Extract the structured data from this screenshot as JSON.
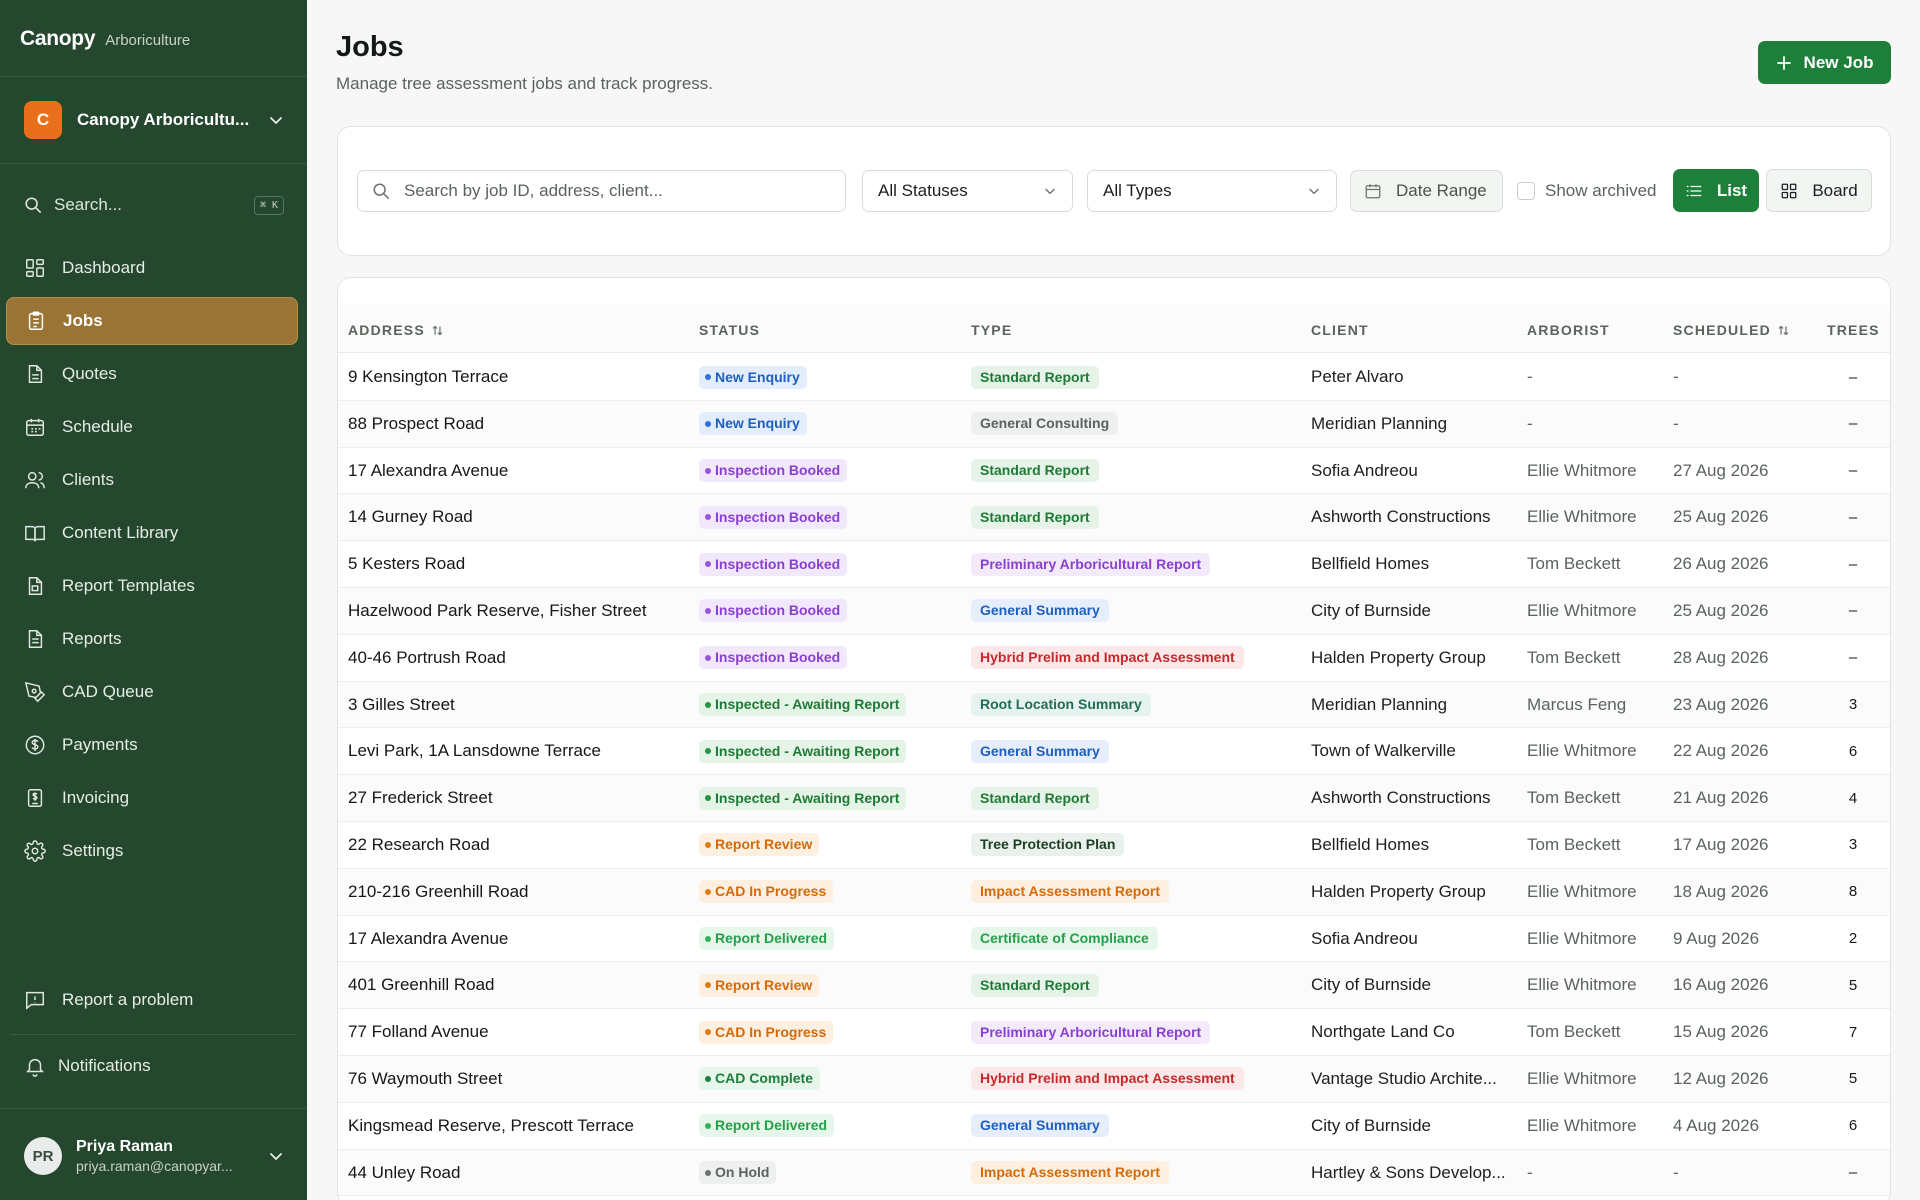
{
  "app": {
    "brand": "Canopy",
    "brand_sub": "Arboriculture"
  },
  "org": {
    "initial": "C",
    "name": "Canopy Arboricultu..."
  },
  "sidebar": {
    "search_label": "Search...",
    "search_shortcut": "⌘ K",
    "items": [
      {
        "label": "Dashboard",
        "icon": "dashboard-icon",
        "active": false
      },
      {
        "label": "Jobs",
        "icon": "clipboard-icon",
        "active": true
      },
      {
        "label": "Quotes",
        "icon": "document-icon",
        "active": false
      },
      {
        "label": "Schedule",
        "icon": "calendar-icon",
        "active": false
      },
      {
        "label": "Clients",
        "icon": "users-icon",
        "active": false
      },
      {
        "label": "Content Library",
        "icon": "book-icon",
        "active": false
      },
      {
        "label": "Report Templates",
        "icon": "template-icon",
        "active": false
      },
      {
        "label": "Reports",
        "icon": "report-icon",
        "active": false
      },
      {
        "label": "CAD Queue",
        "icon": "pen-tool-icon",
        "active": false
      },
      {
        "label": "Payments",
        "icon": "dollar-icon",
        "active": false
      },
      {
        "label": "Invoicing",
        "icon": "invoice-icon",
        "active": false
      },
      {
        "label": "Settings",
        "icon": "gear-icon",
        "active": false
      }
    ],
    "report_problem": "Report a problem",
    "notifications": "Notifications",
    "user": {
      "initials": "PR",
      "name": "Priya Raman",
      "email": "priya.raman@canopyar..."
    }
  },
  "header": {
    "title": "Jobs",
    "subtitle": "Manage tree assessment jobs and track progress.",
    "new_job_label": "New Job"
  },
  "filters": {
    "search_placeholder": "Search by job ID, address, client...",
    "status_select": "All Statuses",
    "type_select": "All Types",
    "date_range": "Date Range",
    "show_archived": "Show archived",
    "list_label": "List",
    "board_label": "Board"
  },
  "table": {
    "columns": [
      "ADDRESS",
      "STATUS",
      "TYPE",
      "CLIENT",
      "ARBORIST",
      "SCHEDULED",
      "TREES"
    ],
    "rows": [
      {
        "address": "9 Kensington Terrace",
        "status": "New Enquiry",
        "type": "Standard Report",
        "client": "Peter Alvaro",
        "arborist": "-",
        "scheduled": "-",
        "trees": "–"
      },
      {
        "address": "88 Prospect Road",
        "status": "New Enquiry",
        "type": "General Consulting",
        "client": "Meridian Planning",
        "arborist": "-",
        "scheduled": "-",
        "trees": "–"
      },
      {
        "address": "17 Alexandra Avenue",
        "status": "Inspection Booked",
        "type": "Standard Report",
        "client": "Sofia Andreou",
        "arborist": "Ellie Whitmore",
        "scheduled": "27 Aug 2026",
        "trees": "–"
      },
      {
        "address": "14 Gurney Road",
        "status": "Inspection Booked",
        "type": "Standard Report",
        "client": "Ashworth Constructions",
        "arborist": "Ellie Whitmore",
        "scheduled": "25 Aug 2026",
        "trees": "–"
      },
      {
        "address": "5 Kesters Road",
        "status": "Inspection Booked",
        "type": "Preliminary Arboricultural Report",
        "client": "Bellfield Homes",
        "arborist": "Tom Beckett",
        "scheduled": "26 Aug 2026",
        "trees": "–"
      },
      {
        "address": "Hazelwood Park Reserve, Fisher Street",
        "status": "Inspection Booked",
        "type": "General Summary",
        "client": "City of Burnside",
        "arborist": "Ellie Whitmore",
        "scheduled": "25 Aug 2026",
        "trees": "–"
      },
      {
        "address": "40-46 Portrush Road",
        "status": "Inspection Booked",
        "type": "Hybrid Prelim and Impact Assessment",
        "client": "Halden Property Group",
        "arborist": "Tom Beckett",
        "scheduled": "28 Aug 2026",
        "trees": "–"
      },
      {
        "address": "3 Gilles Street",
        "status": "Inspected - Awaiting Report",
        "type": "Root Location Summary",
        "client": "Meridian Planning",
        "arborist": "Marcus Feng",
        "scheduled": "23 Aug 2026",
        "trees": "3"
      },
      {
        "address": "Levi Park, 1A Lansdowne Terrace",
        "status": "Inspected - Awaiting Report",
        "type": "General Summary",
        "client": "Town of Walkerville",
        "arborist": "Ellie Whitmore",
        "scheduled": "22 Aug 2026",
        "trees": "6"
      },
      {
        "address": "27 Frederick Street",
        "status": "Inspected - Awaiting Report",
        "type": "Standard Report",
        "client": "Ashworth Constructions",
        "arborist": "Tom Beckett",
        "scheduled": "21 Aug 2026",
        "trees": "4"
      },
      {
        "address": "22 Research Road",
        "status": "Report Review",
        "type": "Tree Protection Plan",
        "client": "Bellfield Homes",
        "arborist": "Tom Beckett",
        "scheduled": "17 Aug 2026",
        "trees": "3"
      },
      {
        "address": "210-216 Greenhill Road",
        "status": "CAD In Progress",
        "type": "Impact Assessment Report",
        "client": "Halden Property Group",
        "arborist": "Ellie Whitmore",
        "scheduled": "18 Aug 2026",
        "trees": "8"
      },
      {
        "address": "17 Alexandra Avenue",
        "status": "Report Delivered",
        "type": "Certificate of Compliance",
        "client": "Sofia Andreou",
        "arborist": "Ellie Whitmore",
        "scheduled": "9 Aug 2026",
        "trees": "2"
      },
      {
        "address": "401 Greenhill Road",
        "status": "Report Review",
        "type": "Standard Report",
        "client": "City of Burnside",
        "arborist": "Ellie Whitmore",
        "scheduled": "16 Aug 2026",
        "trees": "5"
      },
      {
        "address": "77 Folland Avenue",
        "status": "CAD In Progress",
        "type": "Preliminary Arboricultural Report",
        "client": "Northgate Land Co",
        "arborist": "Tom Beckett",
        "scheduled": "15 Aug 2026",
        "trees": "7"
      },
      {
        "address": "76 Waymouth Street",
        "status": "CAD Complete",
        "type": "Hybrid Prelim and Impact Assessment",
        "client": "Vantage Studio Archite...",
        "arborist": "Ellie Whitmore",
        "scheduled": "12 Aug 2026",
        "trees": "5"
      },
      {
        "address": "Kingsmead Reserve, Prescott Terrace",
        "status": "Report Delivered",
        "type": "General Summary",
        "client": "City of Burnside",
        "arborist": "Ellie Whitmore",
        "scheduled": "4 Aug 2026",
        "trees": "6"
      },
      {
        "address": "44 Unley Road",
        "status": "On Hold",
        "type": "Impact Assessment Report",
        "client": "Hartley & Sons Develop...",
        "arborist": "-",
        "scheduled": "-",
        "trees": "–"
      }
    ]
  },
  "colors": {
    "sidebar_bg": "#25472e",
    "accent_green": "#1d7f3a",
    "active_nav": "#9a7434",
    "status": {
      "New Enquiry": {
        "bg": "#e3edfb",
        "fg": "#1f5fbf",
        "dot": "#2f6fdb"
      },
      "Inspection Booked": {
        "bg": "#f1e8fb",
        "fg": "#8a3fd1",
        "dot": "#9a55dd"
      },
      "Inspected - Awaiting Report": {
        "bg": "#e4f4e7",
        "fg": "#1f7a36",
        "dot": "#27923f"
      },
      "Report Review": {
        "bg": "#fdf0e0",
        "fg": "#d36a0b",
        "dot": "#e07b13"
      },
      "CAD In Progress": {
        "bg": "#fdf0e0",
        "fg": "#d36a0b",
        "dot": "#e07b13"
      },
      "Report Delivered": {
        "bg": "#e6f6ea",
        "fg": "#25a04a",
        "dot": "#2fb356"
      },
      "CAD Complete": {
        "bg": "#e6f6ea",
        "fg": "#1d7f3a",
        "dot": "#1d7f3a"
      },
      "On Hold": {
        "bg": "#eef0ef",
        "fg": "#5b635d",
        "dot": "#6b736d"
      }
    },
    "type": {
      "Standard Report": {
        "bg": "#e6f3e8",
        "fg": "#1f7a36"
      },
      "General Consulting": {
        "bg": "#eef0ef",
        "fg": "#5b635d"
      },
      "Preliminary Arboricultural Report": {
        "bg": "#f3ebfb",
        "fg": "#8a3fd1"
      },
      "General Summary": {
        "bg": "#e6eefb",
        "fg": "#1f5fbf"
      },
      "Hybrid Prelim and Impact Assessment": {
        "bg": "#fce8e8",
        "fg": "#c8282b"
      },
      "Root Location Summary": {
        "bg": "#e7f3f0",
        "fg": "#1f6e55"
      },
      "Tree Protection Plan": {
        "bg": "#eaf1ec",
        "fg": "#1e3f27"
      },
      "Impact Assessment Report": {
        "bg": "#fdf0e0",
        "fg": "#d36a0b"
      },
      "Certificate of Compliance": {
        "bg": "#e6f6ea",
        "fg": "#25a04a"
      }
    }
  }
}
